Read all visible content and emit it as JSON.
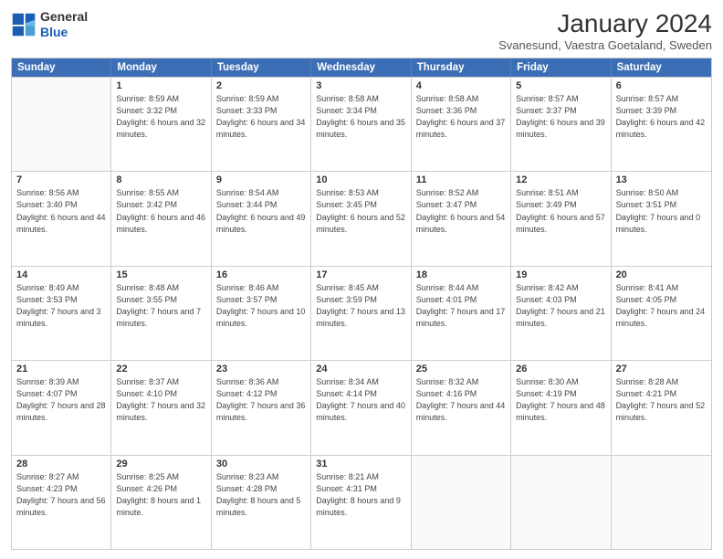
{
  "logo": {
    "line1": "General",
    "line2": "Blue"
  },
  "title": "January 2024",
  "location": "Svanesund, Vaestra Goetaland, Sweden",
  "weekdays": [
    "Sunday",
    "Monday",
    "Tuesday",
    "Wednesday",
    "Thursday",
    "Friday",
    "Saturday"
  ],
  "rows": [
    [
      {
        "day": "",
        "sunrise": "",
        "sunset": "",
        "daylight": ""
      },
      {
        "day": "1",
        "sunrise": "Sunrise: 8:59 AM",
        "sunset": "Sunset: 3:32 PM",
        "daylight": "Daylight: 6 hours and 32 minutes."
      },
      {
        "day": "2",
        "sunrise": "Sunrise: 8:59 AM",
        "sunset": "Sunset: 3:33 PM",
        "daylight": "Daylight: 6 hours and 34 minutes."
      },
      {
        "day": "3",
        "sunrise": "Sunrise: 8:58 AM",
        "sunset": "Sunset: 3:34 PM",
        "daylight": "Daylight: 6 hours and 35 minutes."
      },
      {
        "day": "4",
        "sunrise": "Sunrise: 8:58 AM",
        "sunset": "Sunset: 3:36 PM",
        "daylight": "Daylight: 6 hours and 37 minutes."
      },
      {
        "day": "5",
        "sunrise": "Sunrise: 8:57 AM",
        "sunset": "Sunset: 3:37 PM",
        "daylight": "Daylight: 6 hours and 39 minutes."
      },
      {
        "day": "6",
        "sunrise": "Sunrise: 8:57 AM",
        "sunset": "Sunset: 3:39 PM",
        "daylight": "Daylight: 6 hours and 42 minutes."
      }
    ],
    [
      {
        "day": "7",
        "sunrise": "Sunrise: 8:56 AM",
        "sunset": "Sunset: 3:40 PM",
        "daylight": "Daylight: 6 hours and 44 minutes."
      },
      {
        "day": "8",
        "sunrise": "Sunrise: 8:55 AM",
        "sunset": "Sunset: 3:42 PM",
        "daylight": "Daylight: 6 hours and 46 minutes."
      },
      {
        "day": "9",
        "sunrise": "Sunrise: 8:54 AM",
        "sunset": "Sunset: 3:44 PM",
        "daylight": "Daylight: 6 hours and 49 minutes."
      },
      {
        "day": "10",
        "sunrise": "Sunrise: 8:53 AM",
        "sunset": "Sunset: 3:45 PM",
        "daylight": "Daylight: 6 hours and 52 minutes."
      },
      {
        "day": "11",
        "sunrise": "Sunrise: 8:52 AM",
        "sunset": "Sunset: 3:47 PM",
        "daylight": "Daylight: 6 hours and 54 minutes."
      },
      {
        "day": "12",
        "sunrise": "Sunrise: 8:51 AM",
        "sunset": "Sunset: 3:49 PM",
        "daylight": "Daylight: 6 hours and 57 minutes."
      },
      {
        "day": "13",
        "sunrise": "Sunrise: 8:50 AM",
        "sunset": "Sunset: 3:51 PM",
        "daylight": "Daylight: 7 hours and 0 minutes."
      }
    ],
    [
      {
        "day": "14",
        "sunrise": "Sunrise: 8:49 AM",
        "sunset": "Sunset: 3:53 PM",
        "daylight": "Daylight: 7 hours and 3 minutes."
      },
      {
        "day": "15",
        "sunrise": "Sunrise: 8:48 AM",
        "sunset": "Sunset: 3:55 PM",
        "daylight": "Daylight: 7 hours and 7 minutes."
      },
      {
        "day": "16",
        "sunrise": "Sunrise: 8:46 AM",
        "sunset": "Sunset: 3:57 PM",
        "daylight": "Daylight: 7 hours and 10 minutes."
      },
      {
        "day": "17",
        "sunrise": "Sunrise: 8:45 AM",
        "sunset": "Sunset: 3:59 PM",
        "daylight": "Daylight: 7 hours and 13 minutes."
      },
      {
        "day": "18",
        "sunrise": "Sunrise: 8:44 AM",
        "sunset": "Sunset: 4:01 PM",
        "daylight": "Daylight: 7 hours and 17 minutes."
      },
      {
        "day": "19",
        "sunrise": "Sunrise: 8:42 AM",
        "sunset": "Sunset: 4:03 PM",
        "daylight": "Daylight: 7 hours and 21 minutes."
      },
      {
        "day": "20",
        "sunrise": "Sunrise: 8:41 AM",
        "sunset": "Sunset: 4:05 PM",
        "daylight": "Daylight: 7 hours and 24 minutes."
      }
    ],
    [
      {
        "day": "21",
        "sunrise": "Sunrise: 8:39 AM",
        "sunset": "Sunset: 4:07 PM",
        "daylight": "Daylight: 7 hours and 28 minutes."
      },
      {
        "day": "22",
        "sunrise": "Sunrise: 8:37 AM",
        "sunset": "Sunset: 4:10 PM",
        "daylight": "Daylight: 7 hours and 32 minutes."
      },
      {
        "day": "23",
        "sunrise": "Sunrise: 8:36 AM",
        "sunset": "Sunset: 4:12 PM",
        "daylight": "Daylight: 7 hours and 36 minutes."
      },
      {
        "day": "24",
        "sunrise": "Sunrise: 8:34 AM",
        "sunset": "Sunset: 4:14 PM",
        "daylight": "Daylight: 7 hours and 40 minutes."
      },
      {
        "day": "25",
        "sunrise": "Sunrise: 8:32 AM",
        "sunset": "Sunset: 4:16 PM",
        "daylight": "Daylight: 7 hours and 44 minutes."
      },
      {
        "day": "26",
        "sunrise": "Sunrise: 8:30 AM",
        "sunset": "Sunset: 4:19 PM",
        "daylight": "Daylight: 7 hours and 48 minutes."
      },
      {
        "day": "27",
        "sunrise": "Sunrise: 8:28 AM",
        "sunset": "Sunset: 4:21 PM",
        "daylight": "Daylight: 7 hours and 52 minutes."
      }
    ],
    [
      {
        "day": "28",
        "sunrise": "Sunrise: 8:27 AM",
        "sunset": "Sunset: 4:23 PM",
        "daylight": "Daylight: 7 hours and 56 minutes."
      },
      {
        "day": "29",
        "sunrise": "Sunrise: 8:25 AM",
        "sunset": "Sunset: 4:26 PM",
        "daylight": "Daylight: 8 hours and 1 minute."
      },
      {
        "day": "30",
        "sunrise": "Sunrise: 8:23 AM",
        "sunset": "Sunset: 4:28 PM",
        "daylight": "Daylight: 8 hours and 5 minutes."
      },
      {
        "day": "31",
        "sunrise": "Sunrise: 8:21 AM",
        "sunset": "Sunset: 4:31 PM",
        "daylight": "Daylight: 8 hours and 9 minutes."
      },
      {
        "day": "",
        "sunrise": "",
        "sunset": "",
        "daylight": ""
      },
      {
        "day": "",
        "sunrise": "",
        "sunset": "",
        "daylight": ""
      },
      {
        "day": "",
        "sunrise": "",
        "sunset": "",
        "daylight": ""
      }
    ]
  ]
}
